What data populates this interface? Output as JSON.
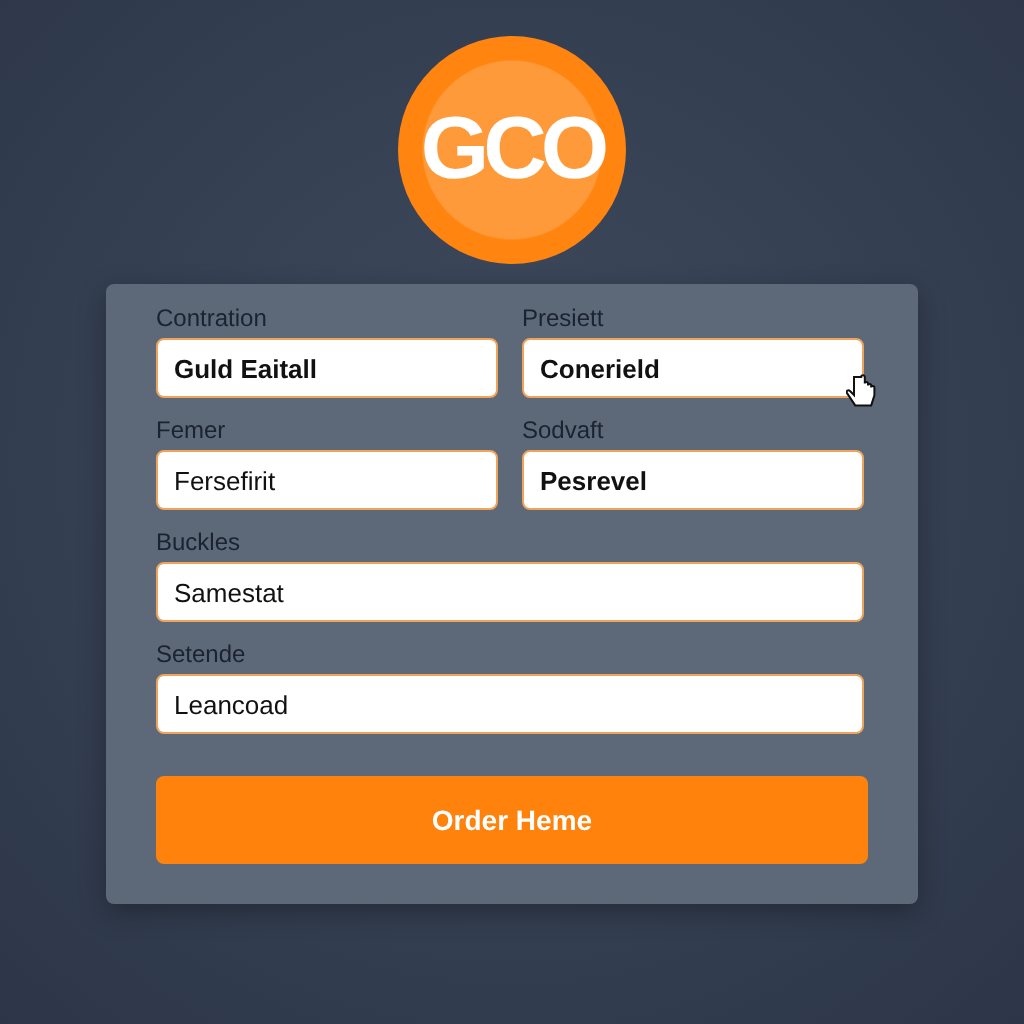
{
  "logo": {
    "text": "GCO"
  },
  "fields": [
    {
      "label": "Contration",
      "value": "Guld Eaitall",
      "bold": true,
      "kind": "half"
    },
    {
      "label": "Presiett",
      "value": "Conerield",
      "bold": true,
      "kind": "half"
    },
    {
      "label": "Femer",
      "value": "Fersefirit",
      "bold": false,
      "kind": "half"
    },
    {
      "label": "Sodvaft",
      "value": "Pesrevel",
      "bold": true,
      "kind": "half"
    },
    {
      "label": "Buckles",
      "value": "Samestat",
      "bold": false,
      "kind": "full"
    },
    {
      "label": "Setende",
      "value": "Leancoad",
      "bold": false,
      "kind": "full"
    }
  ],
  "button": {
    "label": "Order Heme"
  }
}
